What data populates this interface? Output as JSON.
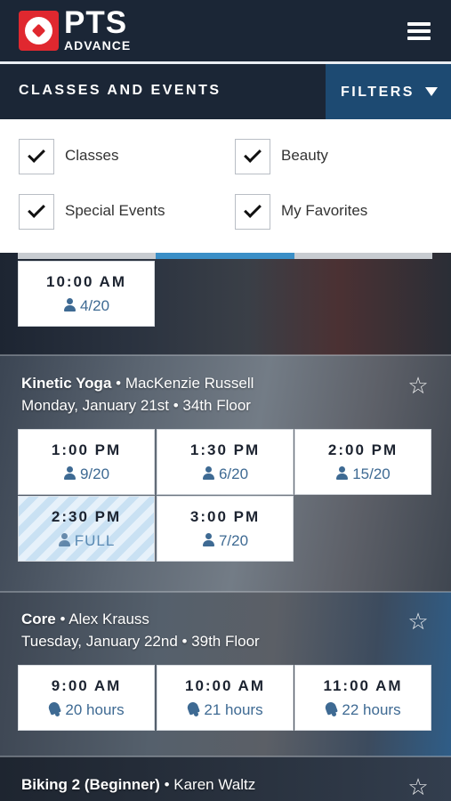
{
  "header": {
    "logo_top": "PTS",
    "logo_bottom": "ADVANCE"
  },
  "section": {
    "title": "CLASSES AND EVENTS",
    "filters_label": "FILTERS"
  },
  "filters": [
    {
      "label": "Classes",
      "checked": true
    },
    {
      "label": "Beauty",
      "checked": true
    },
    {
      "label": "Special Events",
      "checked": true
    },
    {
      "label": "My Favorites",
      "checked": true
    }
  ],
  "top_slot": {
    "time": "10:00 AM",
    "capacity": "4/20"
  },
  "classes": [
    {
      "name": "Kinetic Yoga",
      "instructor": "• MacKenzie Russell",
      "when": "Monday, January 21st • 34th Floor",
      "slots": [
        {
          "time": "1:00 PM",
          "capacity": "9/20"
        },
        {
          "time": "1:30 PM",
          "capacity": "6/20"
        },
        {
          "time": "2:00 PM",
          "capacity": "15/20"
        },
        {
          "time": "2:30 PM",
          "capacity": "FULL"
        },
        {
          "time": "3:00 PM",
          "capacity": "7/20"
        }
      ]
    },
    {
      "name": "Core",
      "instructor": "• Alex Krauss",
      "when": "Tuesday, January 22nd • 39th Floor",
      "slots": [
        {
          "time": "9:00 AM",
          "opens": "20 hours"
        },
        {
          "time": "10:00 AM",
          "opens": "21 hours"
        },
        {
          "time": "11:00 AM",
          "opens": "22 hours"
        }
      ]
    },
    {
      "name": "Biking 2 (Beginner)",
      "instructor": "• Karen Waltz"
    }
  ],
  "colors": {
    "navy": "#1b2636",
    "filters_blue": "#1d4a72",
    "accent_blue": "#3b8fc7",
    "brand_red": "#e0282f",
    "capacity_blue": "#3e6a93"
  },
  "icons": [
    "logo-ball-icon",
    "hamburger-menu-icon",
    "caret-down-icon",
    "checkmark-icon",
    "person-icon",
    "bell-icon",
    "star-icon"
  ]
}
